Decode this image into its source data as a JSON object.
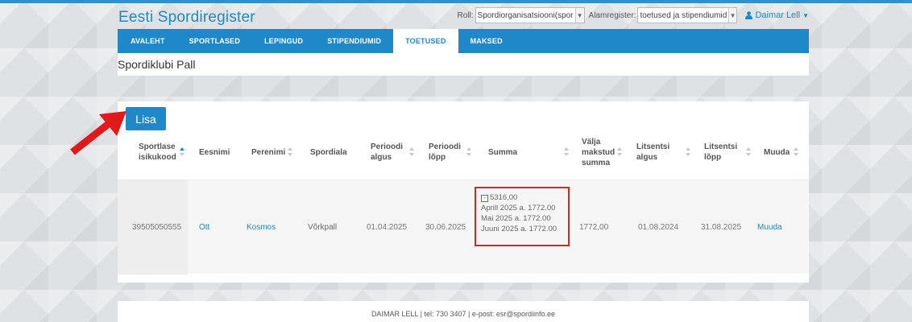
{
  "header": {
    "brand": "Eesti Spordiregister",
    "role_label": "Roll:",
    "role_value": "Spordiorganisatsiooni(spor",
    "subregister_label": "Alamregister:",
    "subregister_value": "toetused ja stipendiumid",
    "user_name": "Daimar Lell"
  },
  "nav": {
    "items": [
      "AVALEHT",
      "SPORTLASED",
      "LEPINGUD",
      "STIPENDIUMID",
      "TOETUSED",
      "MAKSED"
    ],
    "active": "TOETUSED"
  },
  "club_name": "Spordiklubi Pall",
  "add_button": "Lisa",
  "table": {
    "headers": {
      "isikukood_1": "Sportlase",
      "isikukood_2": "isikukood",
      "eesnimi": "Eesnimi",
      "perenimi": "Perenimi",
      "spordiala": "Spordiala",
      "algus_1": "Perioodi",
      "algus_2": "algus",
      "lopp_1": "Perioodi",
      "lopp_2": "lõpp",
      "summa": "Summa",
      "valja_1": "Välja",
      "valja_2": "makstud",
      "valja_3": "summa",
      "lit_algus_1": "Litsentsi",
      "lit_algus_2": "algus",
      "lit_lopp_1": "Litsentsi",
      "lit_lopp_2": "lõpp",
      "muuda": "Muuda"
    },
    "row": {
      "isikukood": "39505050555",
      "eesnimi": "Ott",
      "perenimi": "Kosmos",
      "spordiala": "Võrkpall",
      "algus": "01.04.2025",
      "lopp": "30.06.2025",
      "summa_total": "5316,00",
      "summa_lines": [
        "Aprill 2025 a. 1772.00",
        "Mai 2025 a. 1772.00",
        "Juuni 2025 a. 1772.00"
      ],
      "valja_makstud": "1772,00",
      "lit_algus": "01.08.2024",
      "lit_lopp": "31.08.2025",
      "muuda": "Muuda"
    }
  },
  "footer": "DAIMAR LELL | tel: 730 3407 | e-post: esr@spordiinfo.ee",
  "colors": {
    "primary": "#1f88c9",
    "highlight": "#e02020"
  }
}
